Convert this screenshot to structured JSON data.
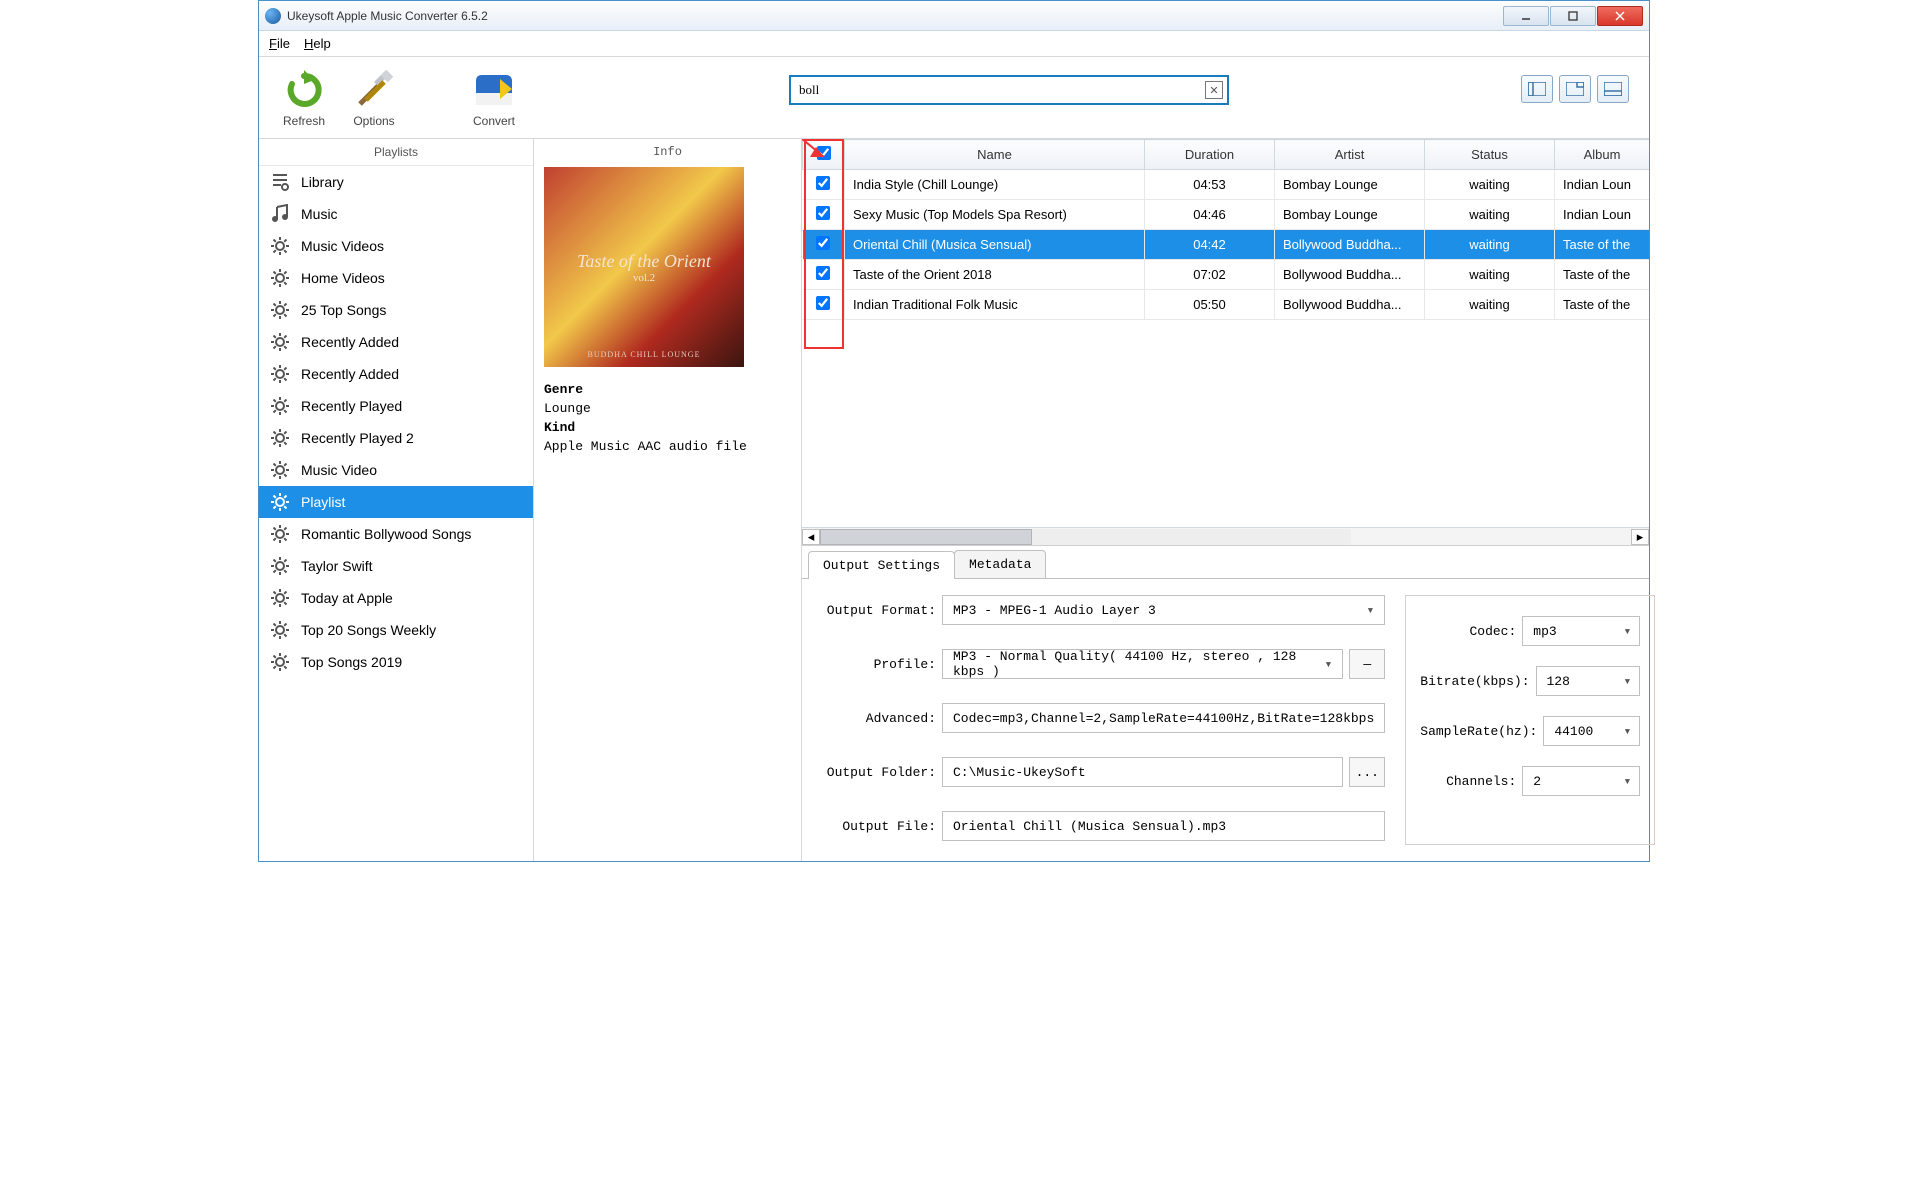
{
  "window": {
    "title": "Ukeysoft Apple Music Converter 6.5.2"
  },
  "menu": {
    "file": "File",
    "help": "Help"
  },
  "toolbar": {
    "refresh": "Refresh",
    "options": "Options",
    "convert": "Convert"
  },
  "search": {
    "value": "boll"
  },
  "sidebar": {
    "header": "Playlists",
    "items": [
      {
        "name": "Library",
        "icon": "library"
      },
      {
        "name": "Music",
        "icon": "music-note"
      },
      {
        "name": "Music Videos",
        "icon": "gear"
      },
      {
        "name": "Home Videos",
        "icon": "gear"
      },
      {
        "name": "25 Top Songs",
        "icon": "gear"
      },
      {
        "name": "Recently Added",
        "icon": "gear"
      },
      {
        "name": "Recently Added",
        "icon": "gear"
      },
      {
        "name": "Recently Played",
        "icon": "gear"
      },
      {
        "name": "Recently Played 2",
        "icon": "gear"
      },
      {
        "name": "Music Video",
        "icon": "gear"
      },
      {
        "name": "Playlist",
        "icon": "gear",
        "selected": true
      },
      {
        "name": "Romantic Bollywood Songs",
        "icon": "gear"
      },
      {
        "name": "Taylor Swift",
        "icon": "gear"
      },
      {
        "name": "Today at Apple",
        "icon": "gear"
      },
      {
        "name": "Top 20 Songs Weekly",
        "icon": "gear"
      },
      {
        "name": "Top Songs 2019",
        "icon": "gear"
      }
    ]
  },
  "info": {
    "header": "Info",
    "cover_title": "Taste of the Orient",
    "cover_sub": "vol.2",
    "cover_footer": "BUDDHA CHILL LOUNGE",
    "genre_label": "Genre",
    "genre_value": "Lounge",
    "kind_label": "Kind",
    "kind_value": "Apple Music AAC audio file"
  },
  "table": {
    "columns": {
      "name": "Name",
      "duration": "Duration",
      "artist": "Artist",
      "status": "Status",
      "album": "Album"
    },
    "rows": [
      {
        "name": "India Style (Chill Lounge)",
        "duration": "04:53",
        "artist": "Bombay Lounge",
        "status": "waiting",
        "album": "Indian Loun"
      },
      {
        "name": "Sexy Music (Top Models Spa Resort)",
        "duration": "04:46",
        "artist": "Bombay Lounge",
        "status": "waiting",
        "album": "Indian Loun"
      },
      {
        "name": "Oriental Chill (Musica Sensual)",
        "duration": "04:42",
        "artist": "Bollywood Buddha...",
        "status": "waiting",
        "album": "Taste of the",
        "selected": true
      },
      {
        "name": "Taste of the Orient 2018",
        "duration": "07:02",
        "artist": "Bollywood Buddha...",
        "status": "waiting",
        "album": "Taste of the"
      },
      {
        "name": "Indian Traditional Folk Music",
        "duration": "05:50",
        "artist": "Bollywood Buddha...",
        "status": "waiting",
        "album": "Taste of the"
      }
    ]
  },
  "tabs": {
    "output": "Output Settings",
    "metadata": "Metadata"
  },
  "settings": {
    "output_format_label": "Output Format:",
    "output_format_value": "MP3 - MPEG-1 Audio Layer 3",
    "profile_label": "Profile:",
    "profile_value": "MP3 - Normal Quality( 44100 Hz, stereo , 128 kbps )",
    "profile_btn": "—",
    "advanced_label": "Advanced:",
    "advanced_value": "Codec=mp3,Channel=2,SampleRate=44100Hz,BitRate=128kbps",
    "folder_label": "Output Folder:",
    "folder_value": "C:\\Music-UkeySoft",
    "folder_btn": "...",
    "file_label": "Output File:",
    "file_value": "Oriental Chill (Musica Sensual).mp3",
    "codec_label": "Codec:",
    "codec_value": "mp3",
    "bitrate_label": "Bitrate(kbps):",
    "bitrate_value": "128",
    "samplerate_label": "SampleRate(hz):",
    "samplerate_value": "44100",
    "channels_label": "Channels:",
    "channels_value": "2"
  }
}
